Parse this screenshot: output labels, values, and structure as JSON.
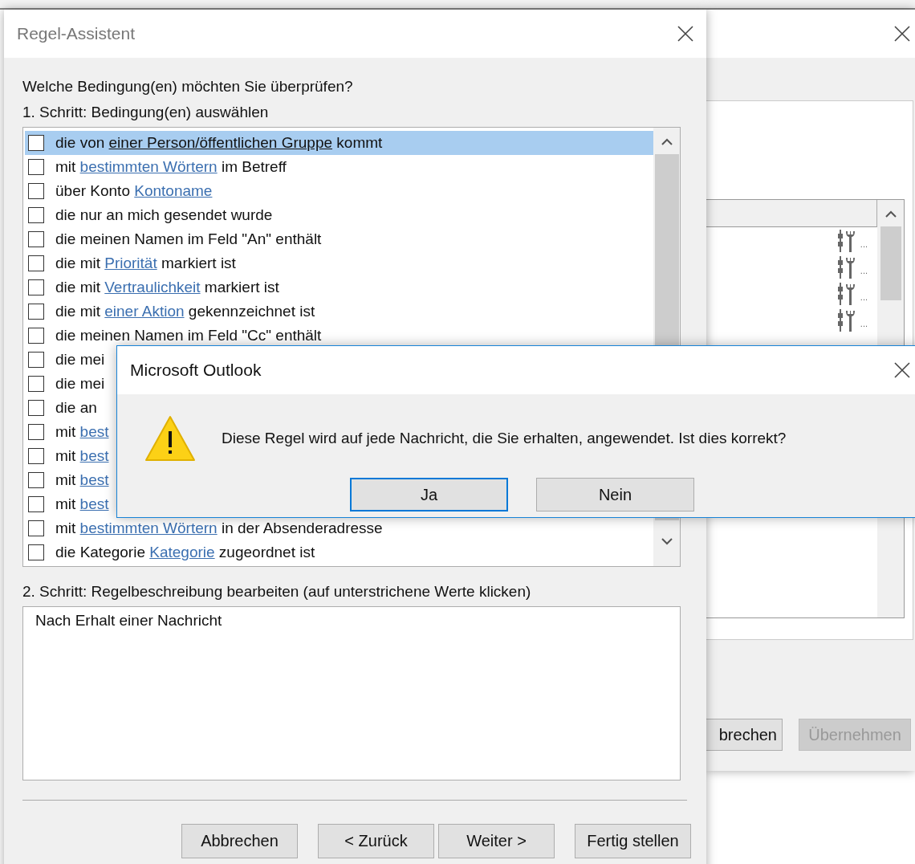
{
  "background_window": {
    "list_rows": [
      {
        "cell": "..."
      },
      {
        "cell": "..."
      },
      {
        "cell": "..."
      },
      {
        "cell": "..."
      }
    ],
    "buttons": [
      {
        "label": "brechen",
        "disabled": false
      },
      {
        "label": "Übernehmen",
        "disabled": true
      }
    ]
  },
  "rules_wizard": {
    "title": "Regel-Assistent",
    "question": "Welche Bedingung(en) möchten Sie überprüfen?",
    "step1_label": "1. Schritt: Bedingung(en) auswählen",
    "conditions": [
      {
        "checked": false,
        "selected": true,
        "parts": [
          {
            "kind": "plain",
            "text": "die von "
          },
          {
            "kind": "link",
            "text": "einer Person/öffentlichen Gruppe"
          },
          {
            "kind": "plain",
            "text": " kommt"
          }
        ]
      },
      {
        "checked": false,
        "selected": false,
        "parts": [
          {
            "kind": "plain",
            "text": "mit "
          },
          {
            "kind": "link",
            "text": "bestimmten Wörtern"
          },
          {
            "kind": "plain",
            "text": " im Betreff"
          }
        ]
      },
      {
        "checked": false,
        "selected": false,
        "parts": [
          {
            "kind": "plain",
            "text": "über Konto "
          },
          {
            "kind": "link",
            "text": "Kontoname"
          }
        ]
      },
      {
        "checked": false,
        "selected": false,
        "parts": [
          {
            "kind": "plain",
            "text": "die nur an mich gesendet wurde"
          }
        ]
      },
      {
        "checked": false,
        "selected": false,
        "parts": [
          {
            "kind": "plain",
            "text": "die meinen Namen im Feld \"An\" enthält"
          }
        ]
      },
      {
        "checked": false,
        "selected": false,
        "parts": [
          {
            "kind": "plain",
            "text": "die mit "
          },
          {
            "kind": "link",
            "text": "Priorität"
          },
          {
            "kind": "plain",
            "text": " markiert ist"
          }
        ]
      },
      {
        "checked": false,
        "selected": false,
        "parts": [
          {
            "kind": "plain",
            "text": "die mit "
          },
          {
            "kind": "link",
            "text": "Vertraulichkeit"
          },
          {
            "kind": "plain",
            "text": " markiert ist"
          }
        ]
      },
      {
        "checked": false,
        "selected": false,
        "parts": [
          {
            "kind": "plain",
            "text": "die mit "
          },
          {
            "kind": "link",
            "text": "einer Aktion"
          },
          {
            "kind": "plain",
            "text": " gekennzeichnet ist"
          }
        ]
      },
      {
        "checked": false,
        "selected": false,
        "parts": [
          {
            "kind": "plain",
            "text": "die meinen Namen im Feld \"Cc\" enthält"
          }
        ]
      },
      {
        "checked": false,
        "selected": false,
        "parts": [
          {
            "kind": "plain",
            "text": "die mei"
          }
        ]
      },
      {
        "checked": false,
        "selected": false,
        "parts": [
          {
            "kind": "plain",
            "text": "die mei"
          }
        ]
      },
      {
        "checked": false,
        "selected": false,
        "parts": [
          {
            "kind": "plain",
            "text": "die an"
          }
        ]
      },
      {
        "checked": false,
        "selected": false,
        "parts": [
          {
            "kind": "plain",
            "text": "mit "
          },
          {
            "kind": "link",
            "text": "best"
          }
        ]
      },
      {
        "checked": false,
        "selected": false,
        "parts": [
          {
            "kind": "plain",
            "text": "mit "
          },
          {
            "kind": "link",
            "text": "best"
          }
        ]
      },
      {
        "checked": false,
        "selected": false,
        "parts": [
          {
            "kind": "plain",
            "text": "mit "
          },
          {
            "kind": "link",
            "text": "best"
          }
        ]
      },
      {
        "checked": false,
        "selected": false,
        "parts": [
          {
            "kind": "plain",
            "text": "mit "
          },
          {
            "kind": "link",
            "text": "best"
          }
        ]
      },
      {
        "checked": false,
        "selected": false,
        "parts": [
          {
            "kind": "plain",
            "text": "mit "
          },
          {
            "kind": "link",
            "text": "bestimmten Wörtern"
          },
          {
            "kind": "plain",
            "text": " in der Absenderadresse"
          }
        ]
      },
      {
        "checked": false,
        "selected": false,
        "parts": [
          {
            "kind": "plain",
            "text": "die Kategorie "
          },
          {
            "kind": "link",
            "text": "Kategorie"
          },
          {
            "kind": "plain",
            "text": " zugeordnet ist"
          }
        ]
      }
    ],
    "step2_label": "2. Schritt: Regelbeschreibung bearbeiten (auf unterstrichene Werte klicken)",
    "description": "Nach Erhalt einer Nachricht",
    "buttons": [
      {
        "label": "Abbrechen"
      },
      {
        "label": "< Zurück"
      },
      {
        "label": "Weiter >"
      },
      {
        "label": "Fertig stellen"
      }
    ]
  },
  "message_box": {
    "title": "Microsoft Outlook",
    "message": "Diese Regel wird auf jede Nachricht, die Sie erhalten, angewendet. Ist dies korrekt?",
    "buttons": [
      {
        "label": "Ja",
        "focused": true
      },
      {
        "label": "Nein",
        "focused": false
      }
    ]
  }
}
